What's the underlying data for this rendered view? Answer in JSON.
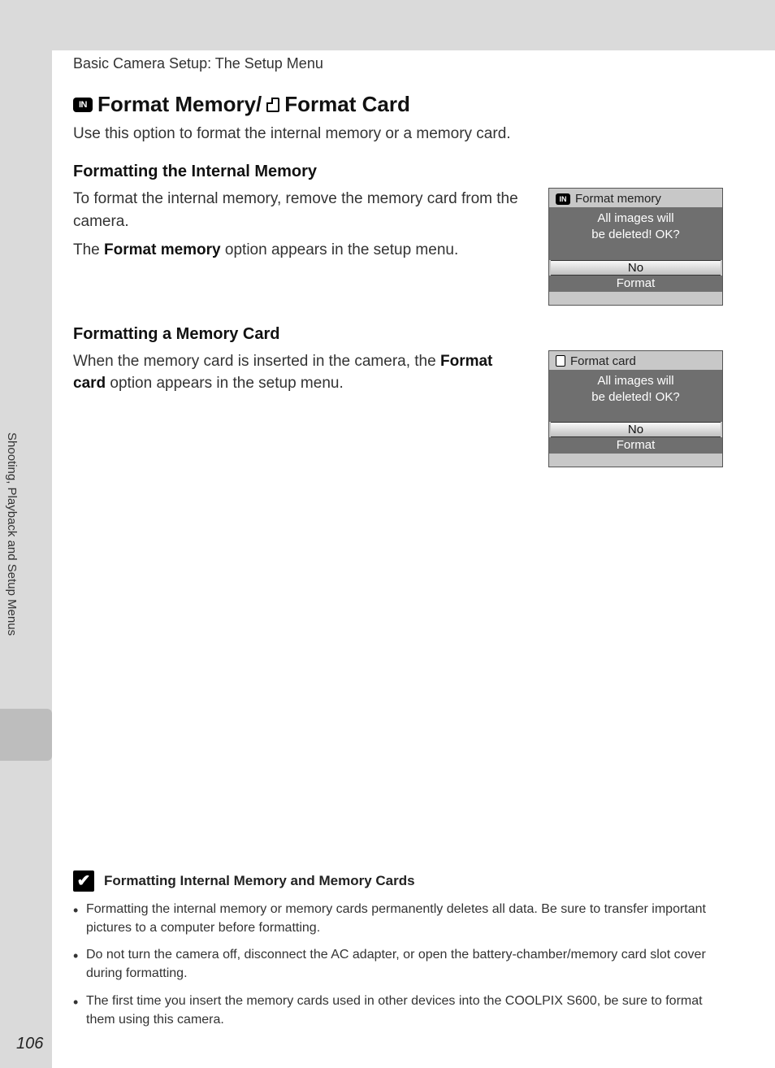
{
  "header": "Basic Camera Setup: The Setup Menu",
  "title_part1": "Format Memory/",
  "title_part2": "Format Card",
  "intro": "Use this option to format the internal memory or a memory card.",
  "section1": {
    "heading": "Formatting the Internal Memory",
    "p1a": "To format the internal memory, remove the memory card from the camera.",
    "p1b_pre": "The ",
    "p1b_bold": "Format memory",
    "p1b_post": " option appears in the setup menu."
  },
  "lcd1": {
    "title": "Format memory",
    "msg1": "All images will",
    "msg2": "be deleted! OK?",
    "btn_no": "No",
    "btn_fmt": "Format"
  },
  "section2": {
    "heading": "Formatting a Memory Card",
    "p_pre": "When the memory card is inserted in the camera, the ",
    "p_bold": "Format card",
    "p_post": " option appears in the setup menu."
  },
  "lcd2": {
    "title": "Format card",
    "msg1": "All images will",
    "msg2": "be deleted! OK?",
    "btn_no": "No",
    "btn_fmt": "Format"
  },
  "side_label": "Shooting, Playback and Setup Menus",
  "note": {
    "heading": "Formatting Internal Memory and Memory Cards",
    "items": [
      "Formatting the internal memory or memory cards permanently deletes all data. Be sure to transfer important pictures to a computer before formatting.",
      "Do not turn the camera off, disconnect the AC adapter, or open the battery-chamber/memory card slot cover during formatting.",
      "The first time you insert the memory cards used in other devices into the COOLPIX S600, be sure to format them using this camera."
    ]
  },
  "page_number": "106",
  "in_label": "IN"
}
